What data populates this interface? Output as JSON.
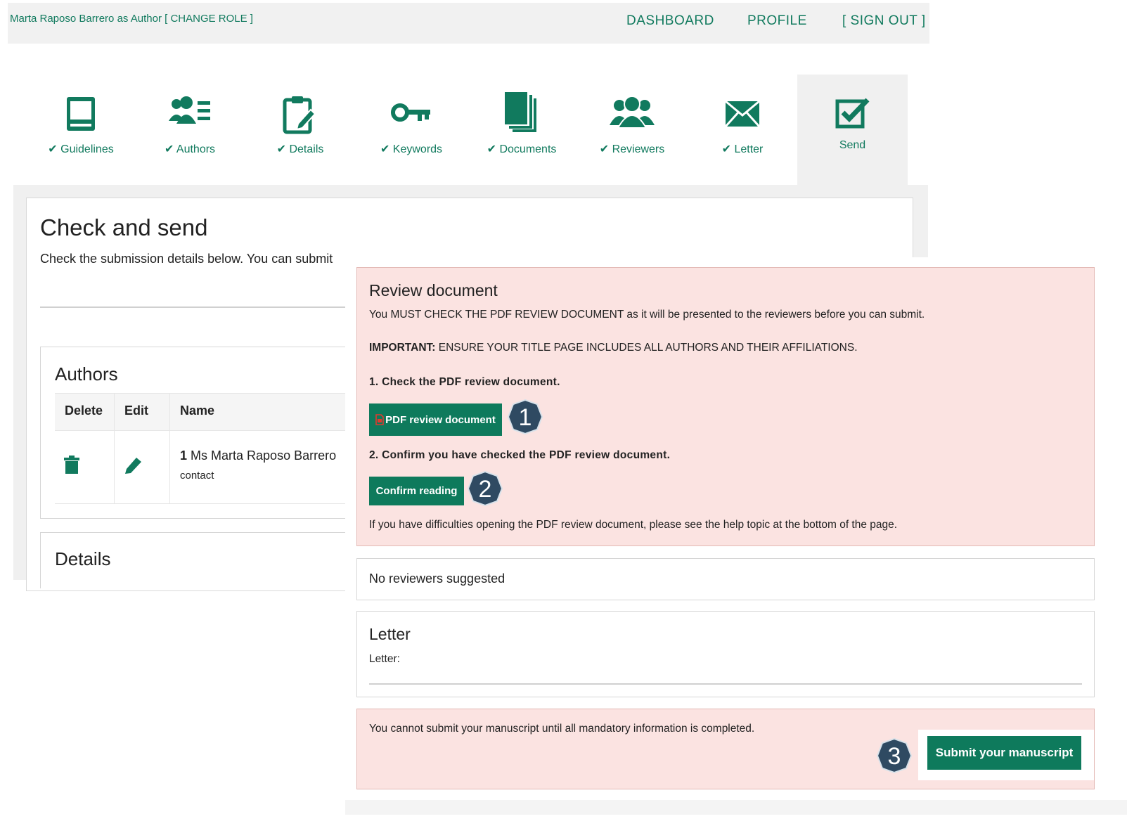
{
  "topbar": {
    "user_label": "Marta Raposo Barrero as Author [ CHANGE ROLE ]",
    "nav": [
      "DASHBOARD",
      "PROFILE",
      "[ SIGN OUT ]"
    ]
  },
  "steps": [
    {
      "label": "✔ Guidelines",
      "icon": "book-icon"
    },
    {
      "label": "✔ Authors",
      "icon": "users-list-icon"
    },
    {
      "label": "✔ Details",
      "icon": "clipboard-edit-icon"
    },
    {
      "label": "✔ Keywords",
      "icon": "key-icon"
    },
    {
      "label": "✔ Documents",
      "icon": "documents-icon"
    },
    {
      "label": "✔ Reviewers",
      "icon": "reviewers-icon"
    },
    {
      "label": "✔ Letter",
      "icon": "envelope-icon"
    },
    {
      "label": "Send",
      "icon": "check-square-icon",
      "active": true
    }
  ],
  "main": {
    "title": "Check and send",
    "description": "Check the submission details below. You can submit"
  },
  "authors": {
    "title": "Authors",
    "columns": [
      "Delete",
      "Edit",
      "Name"
    ],
    "rows": [
      {
        "number": "1",
        "name": "Ms Marta Raposo Barrero",
        "role": "contact"
      }
    ]
  },
  "details": {
    "title": "Details"
  },
  "review": {
    "title": "Review document",
    "text": "You MUST CHECK THE PDF REVIEW DOCUMENT as it will be presented to the reviewers before you can submit.",
    "important_label": "IMPORTANT:",
    "important_text": " ENSURE YOUR TITLE PAGE INCLUDES ALL AUTHORS AND THEIR AFFILIATIONS.",
    "step1": "1. Check the PDF review document.",
    "pdf_button": "PDF review document",
    "step2": "2. Confirm you have checked the PDF review document.",
    "confirm_button": "Confirm reading",
    "help": "If you have difficulties opening the PDF review document, please see the help topic at the bottom of the page."
  },
  "reviewers": {
    "text": "No reviewers suggested"
  },
  "letter": {
    "title": "Letter",
    "label": "Letter:"
  },
  "submit": {
    "text": "You cannot submit your manuscript until all mandatory information is completed.",
    "button": "Submit your manuscript"
  },
  "badges": [
    "1",
    "2",
    "3"
  ],
  "colors": {
    "accent": "#0e7a5c",
    "alert_bg": "#fbe3e1",
    "badge": "#2f4a62"
  }
}
